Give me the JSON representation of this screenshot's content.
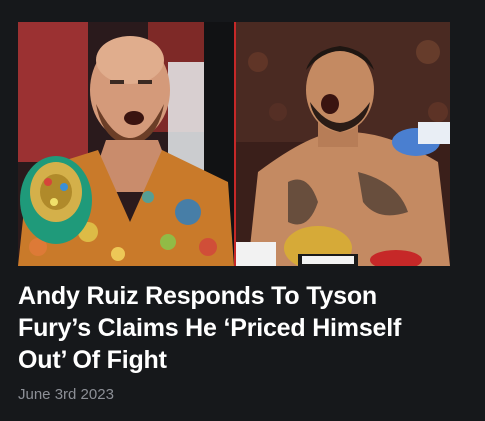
{
  "article": {
    "headline": "Andy Ruiz Responds To Tyson Fury’s Claims He ‘Priced Himself Out’ Of Fight",
    "date": "June 3rd 2023",
    "image": {
      "left_subject": "boxer-with-championship-belt",
      "right_subject": "shirtless-boxer-celebrating",
      "divider_color": "#c62828"
    }
  },
  "colors": {
    "background": "#16181b",
    "headline": "#ffffff",
    "date": "#8c8f96"
  }
}
